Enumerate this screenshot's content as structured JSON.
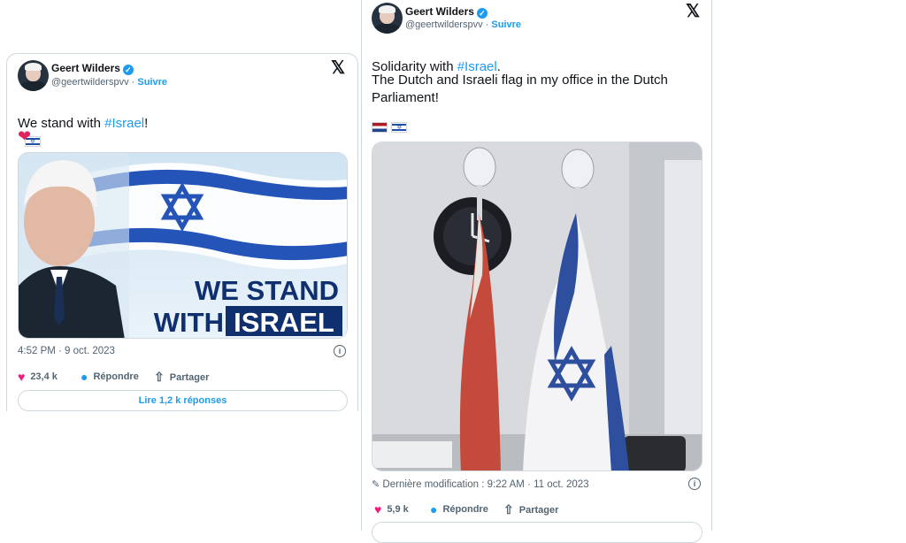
{
  "tweet1": {
    "author": "Geert Wilders",
    "handle": "@geertwilderspvv",
    "sep": "·",
    "follow": "Suivre",
    "text_before": "We stand with ",
    "hashtag": "#Israel",
    "text_after": "!",
    "image_text_line1": "WE STAND",
    "image_text_line2a": "WITH",
    "image_text_line2b": "ISRAEL",
    "timestamp": "4:52 PM · 9 oct. 2023",
    "likes": "23,4 k",
    "reply_label": "Répondre",
    "share_label": "Partager",
    "read_replies": "Lire 1,2 k réponses"
  },
  "tweet2": {
    "author": "Geert Wilders",
    "handle": "@geertwilderspvv",
    "sep": "·",
    "follow": "Suivre",
    "text_before": "Solidarity with ",
    "hashtag": "#Israel",
    "text_after": ".",
    "text_body": "The Dutch and Israeli flag in my office in the Dutch Parliament!",
    "edited": "Dernière modification : 9:22 AM · 11 oct. 2023",
    "likes": "5,9 k",
    "reply_label": "Répondre",
    "share_label": "Partager"
  },
  "colors": {
    "link": "#1d9bf0",
    "like": "#f91880",
    "israel_blue": "#1f4fa8",
    "nl_red": "#ae1c28",
    "nl_blue": "#21468b"
  },
  "icons": [
    "verified-badge-icon",
    "x-logo-icon",
    "heart-icon",
    "reply-bubble-icon",
    "share-icon",
    "info-icon",
    "pencil-icon",
    "israel-flag-emoji",
    "netherlands-flag-emoji",
    "red-heart-emoji"
  ]
}
